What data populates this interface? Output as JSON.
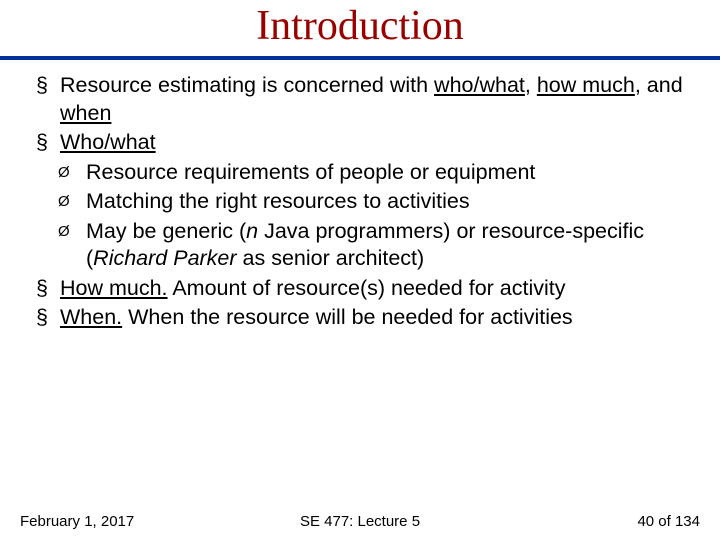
{
  "title": "Introduction",
  "bullets": {
    "b1_pre": "Resource estimating is concerned with ",
    "b1_u1": "who/what",
    "b1_mid1": ", ",
    "b1_u2": "how much",
    "b1_mid2": ", and ",
    "b1_u3": "when",
    "b2": "Who/what",
    "sub1": "Resource requirements of people or equipment",
    "sub2": "Matching the right resources to activities",
    "sub3_a": "May be generic (",
    "sub3_i1": "n",
    "sub3_b": " Java programmers) or resource-specific (",
    "sub3_i2": "Richard Parker",
    "sub3_c": " as senior architect)",
    "b3_u": "How much.",
    "b3_rest": " Amount of resource(s) needed for activity",
    "b4_u": "When.",
    "b4_rest": " When the resource will be needed for activities"
  },
  "footer": {
    "date": "February 1, 2017",
    "course": "SE 477: Lecture 5",
    "page": "40 of 134"
  }
}
